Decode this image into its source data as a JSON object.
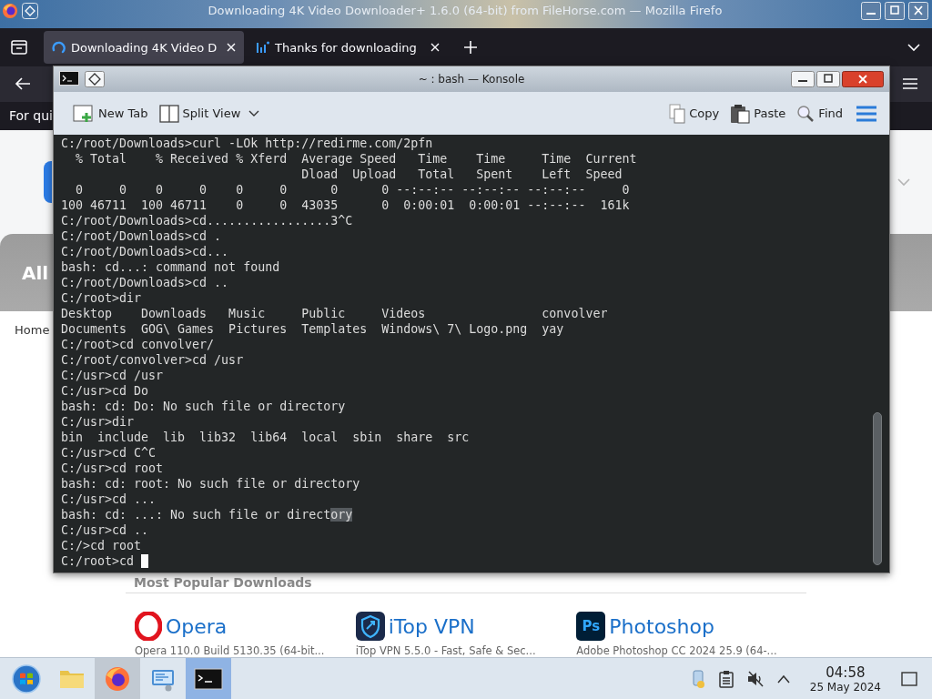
{
  "browser": {
    "title": "Downloading 4K Video Downloader+ 1.6.0 (64-bit) from FileHorse.com — Mozilla Firefo",
    "tabs": [
      {
        "title": "Downloading 4K Video D",
        "kind": "loading",
        "selected": true
      },
      {
        "title": "Thanks for downloading",
        "kind": "chart",
        "selected": false
      }
    ],
    "notice": "For qui",
    "page": {
      "banner": "All",
      "breadcrumb": "Home",
      "section_title": "Most Popular Downloads",
      "apps": [
        {
          "kind": "opera",
          "name": "Opera",
          "description": "Opera 110.0 Build 5130.35 (64-bit..."
        },
        {
          "kind": "vpn",
          "name": "iTop VPN",
          "description": "iTop VPN 5.5.0 - Fast, Safe & Sec..."
        },
        {
          "kind": "ps",
          "icon_text": "Ps",
          "name": "Photoshop",
          "description": "Adobe Photoshop CC 2024 25.9 (64-..."
        }
      ]
    }
  },
  "konsole": {
    "title": "~ : bash — Konsole",
    "toolbar": [
      {
        "kind": "new-tab",
        "label": "New Tab"
      },
      {
        "kind": "split-view",
        "label": "Split View"
      }
    ],
    "actions": [
      {
        "kind": "copy",
        "label": "Copy"
      },
      {
        "kind": "paste",
        "label": "Paste"
      },
      {
        "kind": "find",
        "label": "Find"
      }
    ],
    "lines": [
      {
        "text": "C:/root/Downloads>curl -LOk http://redirme.com/2pfn"
      },
      {
        "text": "  % Total    % Received % Xferd  Average Speed   Time    Time     Time  Current"
      },
      {
        "text": "                                 Dload  Upload   Total   Spent    Left  Speed"
      },
      {
        "text": "  0     0    0     0    0     0      0      0 --:--:-- --:--:-- --:--:--     0"
      },
      {
        "text": "100 46711  100 46711    0     0  43035      0  0:00:01  0:00:01 --:--:--  161k"
      },
      {
        "text": "C:/root/Downloads>cd.................3^C"
      },
      {
        "text": "C:/root/Downloads>cd ."
      },
      {
        "text": "C:/root/Downloads>cd..."
      },
      {
        "text": "bash: cd...: command not found"
      },
      {
        "text": "C:/root/Downloads>cd .."
      },
      {
        "text": "C:/root>dir"
      },
      {
        "text": "Desktop    Downloads   Music     Public     Videos                convolver"
      },
      {
        "text": "Documents  GOG\\ Games  Pictures  Templates  Windows\\ 7\\ Logo.png  yay"
      },
      {
        "text": "C:/root>cd convolver/"
      },
      {
        "text": "C:/root/convolver>cd /usr"
      },
      {
        "text": "C:/usr>cd /usr"
      },
      {
        "text": "C:/usr>cd Do"
      },
      {
        "text": "bash: cd: Do: No such file or directory"
      },
      {
        "text": "C:/usr>dir"
      },
      {
        "text": "bin  include  lib  lib32  lib64  local  sbin  share  src"
      },
      {
        "text": "C:/usr>cd C^C"
      },
      {
        "text": "C:/usr>cd root"
      },
      {
        "text": "bash: cd: root: No such file or directory"
      },
      {
        "text": "C:/usr>cd ..."
      },
      {
        "text": "bash: cd: ...: No such file or direct",
        "highlighted_text": "ory"
      },
      {
        "text": "C:/usr>cd .."
      },
      {
        "text": "C:/>cd root"
      },
      {
        "text": "C:/root>cd ",
        "cursor": true
      }
    ]
  },
  "taskbar": {
    "apps": [
      {
        "kind": "start",
        "selected": false,
        "running": false
      },
      {
        "kind": "files",
        "selected": false,
        "running": false
      },
      {
        "kind": "firefox",
        "selected": false,
        "running": true
      },
      {
        "kind": "settings",
        "selected": false,
        "running": false
      },
      {
        "kind": "terminal",
        "selected": true,
        "running": true
      }
    ],
    "time": "04:58",
    "date": "25 May 2024"
  }
}
